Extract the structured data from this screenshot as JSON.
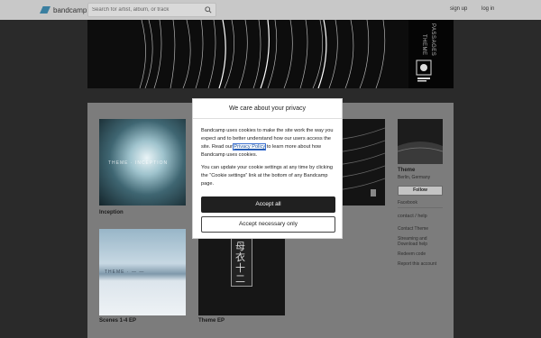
{
  "topbar": {
    "logo_text": "bandcamp",
    "search_placeholder": "Search for artist, album, or track",
    "signup_label": "sign up",
    "login_label": "log in"
  },
  "header": {
    "vertical_title": "THEME",
    "vertical_subtitle": "PASSAGES"
  },
  "albums": [
    {
      "title": "Inception",
      "art_caption": "THEME · INCEPTION"
    },
    {
      "title": "Scenes 1-4 EP",
      "art_caption": "THEME · — —"
    },
    {
      "title": "Theme EP",
      "art_caption": "母衣十二"
    }
  ],
  "sidebar": {
    "artist_name": "Theme",
    "location": "Berlin, Germany",
    "follow_label": "Follow",
    "facebook_label": "Facebook",
    "contact_label": "contact / help",
    "links": [
      {
        "label": "Contact Theme"
      },
      {
        "label": "Streaming and"
      },
      {
        "label": "Download help"
      },
      {
        "label": "Redeem code"
      },
      {
        "label": "Report this account"
      }
    ]
  },
  "modal": {
    "title": "We care about your privacy",
    "paragraph1_before": "Bandcamp uses cookies to make the site work the way you expect and to better understand how our users access the site. Read our ",
    "privacy_link": "Privacy Policy",
    "paragraph1_after": " to learn more about how Bandcamp uses cookies.",
    "paragraph2": "You can update your cookie settings at any time by clicking the “Cookie settings” link at the bottom of any Bandcamp page.",
    "accept_all_label": "Accept all",
    "accept_necessary_label": "Accept necessary only"
  },
  "colors": {
    "topbar_bg": "#c8c8c8",
    "page_bg": "#2a2a2a",
    "content_bg": "#7c7c7c",
    "logo_accent": "#3a7fa0",
    "accept_button_bg": "#202020"
  }
}
